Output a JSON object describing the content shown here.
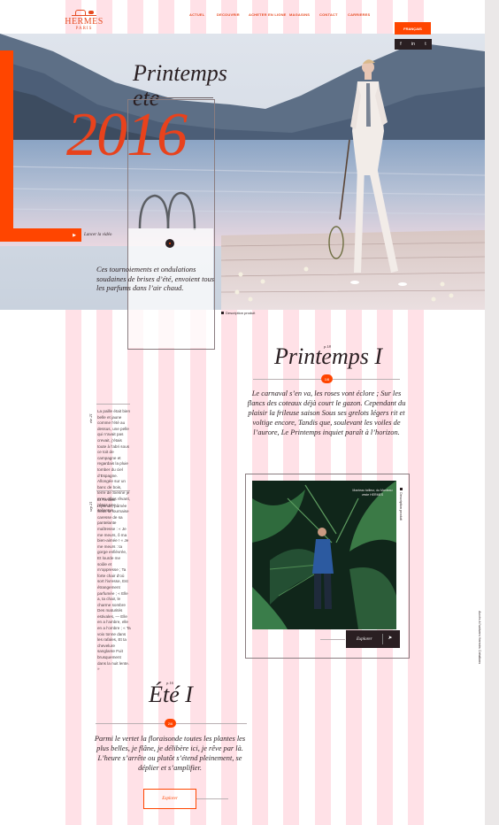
{
  "brand": {
    "name": "HERMES",
    "city": "PARIS",
    "accent": "#ff4500"
  },
  "nav": {
    "items": [
      "ACTUEL",
      "DECOUVRIR",
      "ACHETER EN LIGNE",
      "MAGASINS",
      "CONTACT",
      "CARRIERES"
    ]
  },
  "language": {
    "label": "FRANÇAIS"
  },
  "social": {
    "icons": [
      "f",
      "in",
      "t"
    ]
  },
  "hero": {
    "title_line1": "Printemps",
    "title_line2": "ete",
    "year": "2016",
    "lancer_label": "Lancer la vidéo",
    "quote": "Ces tournoiements et ondulations soudaines de brises d’été, envoient tous les parfums dans l’air chaud.",
    "description_label": "Description produit"
  },
  "printemps": {
    "subtitle": "p.18",
    "title": "Printemps I",
    "badge": "1/6",
    "poem": "Le carnaval s’en va, les roses vont éclore ; Sur les flancs des coteaux déjà court le gazon. Cependant du plaisir la frileuse saison Sous ses grelots légers rit et voltige encore, Tandis que, soulevant les voiles de l’aurore, Le Printemps inquiet paraît à l’horizon."
  },
  "side": {
    "label1": "ete 21",
    "text1": "La paille était bien belle et jaune comme l’été au dessus, une pelle qui n’avait pas crevait, j’étais toute à l’abri sous ce toit de campagne et regardais la pluie tomber du ciel d’Espagne. Allongée sur un banc de bois, terre de Sienne je m’en allais rêvant, j’étais une italienne.",
    "label2": "sep 21",
    "text2": "Et l’enfant répondit, pâmée Sous la fournaise caresse de sa pantelante maîtresse : « Je me meurs, ô ma bien-aimée ! « Je me meurs : ta gorge enfiévrée, Et lourde me soûle et m’oppresse ; Ta forte chair d’où sort l’ivresse, Est étrangement parfumée ; « Elle a, ta chair, le charme sombre Des maturités estivales, — Elle en a l’ambre, elle en a l’ombre ; « Ta voix tonne dans les rafales, Et ta chevelure sanglante Fuit brusquement dans la nuit lente. »"
  },
  "photo_card": {
    "caption": "Manteau tailleur, du Manteau veste HERMES",
    "vertical_label": "Description produit",
    "explore_label": "Explorer",
    "edge_label": "Accès à l’univers Hermès Créations"
  },
  "ete": {
    "subtitle": "p.16",
    "title": "Été I",
    "badge": "2/6",
    "text": "Parmi le vertet la floraisonde toutes les plantes les plus belles, je flâne, je délibère ici, je rêve par là. L’heure s’arrête ou plutôt s’étend pleinement, se déplier et s’amplifier.",
    "explore_label": "Explorer"
  }
}
